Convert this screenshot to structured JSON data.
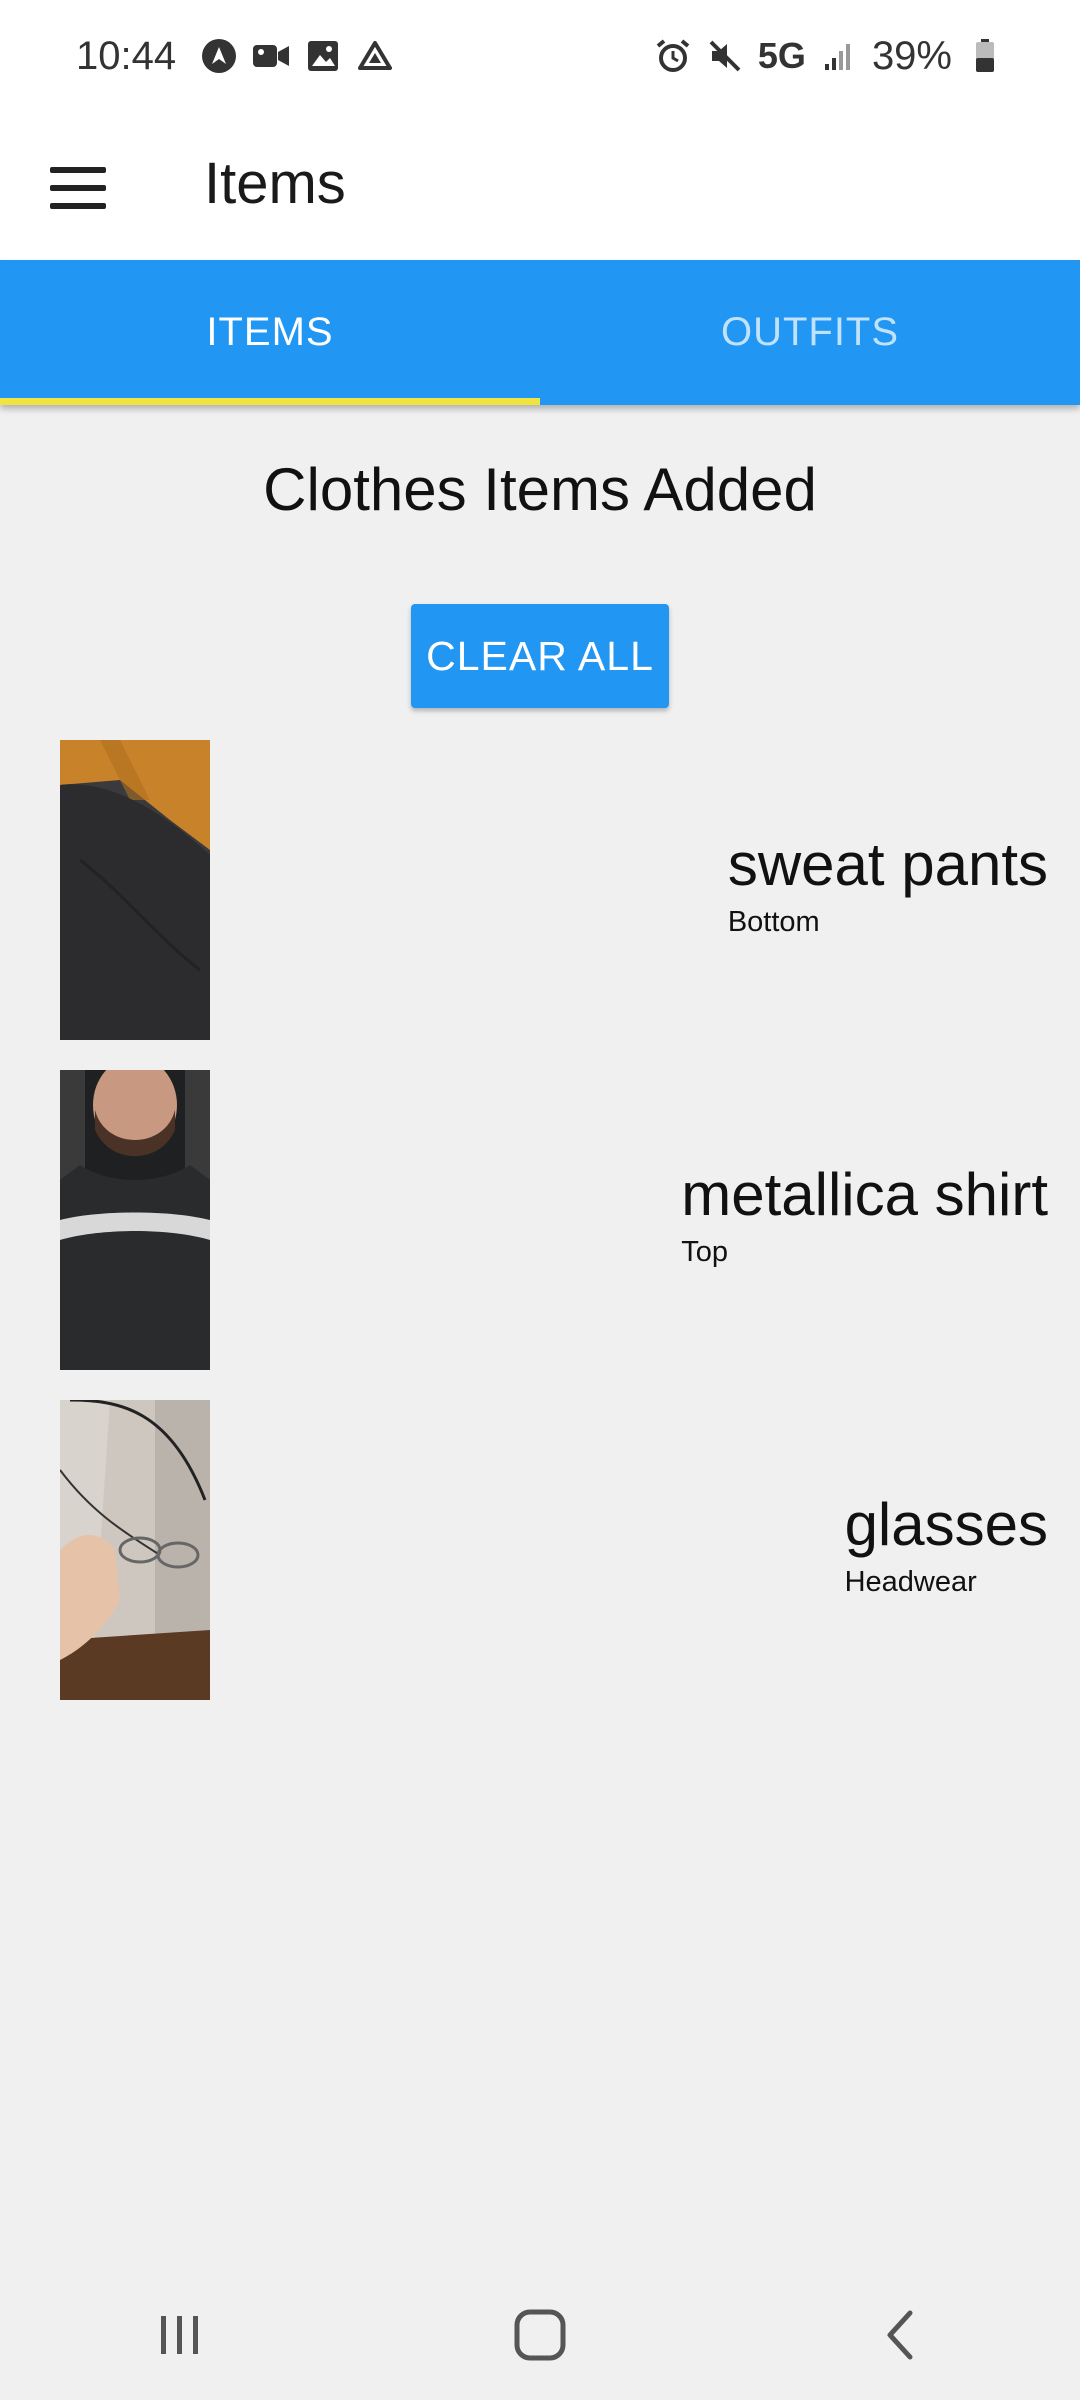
{
  "status_bar": {
    "time": "10:44",
    "left_icons": [
      "android-auto-icon",
      "video-camera-icon",
      "gallery-icon",
      "drive-icon"
    ],
    "right_icons": [
      "alarm-icon",
      "mute-icon"
    ],
    "network": "5G",
    "battery": "39%"
  },
  "app_bar": {
    "title": "Items",
    "menu_icon": "hamburger-menu-icon"
  },
  "tabs": [
    {
      "label": "ITEMS",
      "active": true
    },
    {
      "label": "OUTFITS",
      "active": false
    }
  ],
  "main": {
    "heading": "Clothes Items Added",
    "clear_all_label": "CLEAR ALL",
    "items": [
      {
        "name": "sweat pants",
        "category": "Bottom",
        "thumbnail": "sweat-pants-photo"
      },
      {
        "name": "metallica shirt",
        "category": "Top",
        "thumbnail": "metallica-shirt-photo"
      },
      {
        "name": "glasses",
        "category": "Headwear",
        "thumbnail": "glasses-photo"
      }
    ]
  },
  "colors": {
    "primary": "#2196f3",
    "tab_indicator": "#f0e442",
    "background": "#f0f0f0"
  },
  "nav_bar": {
    "icons": [
      "recent-apps-icon",
      "home-icon",
      "back-icon"
    ]
  }
}
